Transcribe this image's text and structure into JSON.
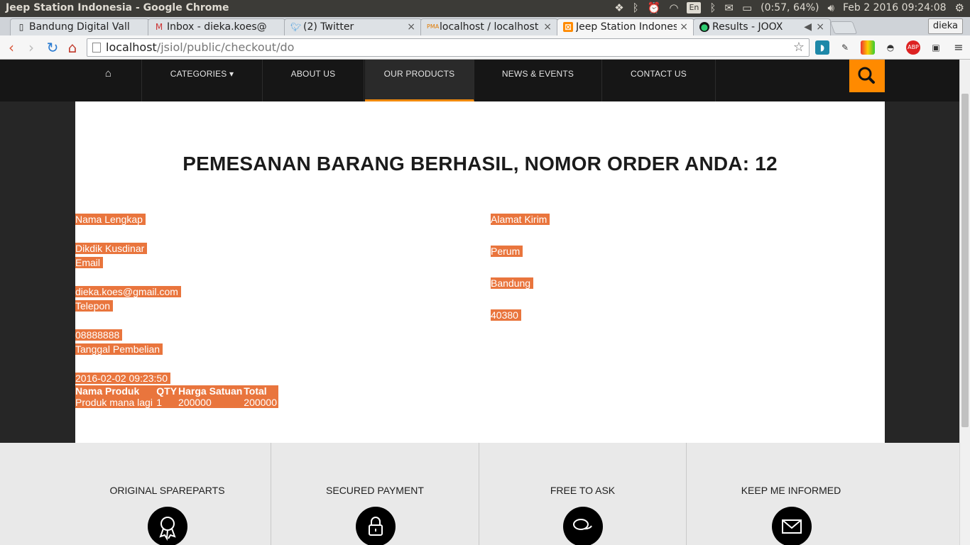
{
  "os": {
    "window_title": "Jeep Station Indonesia - Google Chrome",
    "language": "En",
    "battery": "(0:57, 64%)",
    "datetime": "Feb 2 2016 09:24:08"
  },
  "browser": {
    "tabs": [
      {
        "label": "Bandung Digital Vall",
        "icon": "page-icon"
      },
      {
        "label": "Inbox - dieka.koes@",
        "icon": "gmail-icon"
      },
      {
        "label": "(2) Twitter",
        "icon": "twitter-icon"
      },
      {
        "label": "localhost / localhost",
        "icon": "pma-icon"
      },
      {
        "label": "Jeep Station Indones",
        "icon": "site-icon"
      },
      {
        "label": "Results - JOOX",
        "icon": "joox-icon"
      }
    ],
    "profile": "dieka",
    "url_host": "localhost",
    "url_path": "/jsiol/public/checkout/do"
  },
  "site": {
    "nav": {
      "home": "⌂",
      "items": [
        "CATEGORIES ▾",
        "ABOUT US",
        "OUR PRODUCTS",
        "NEWS & EVENTS",
        "CONTACT US"
      ]
    },
    "headline": "PEMESANAN BARANG BERHASIL, NOMOR ORDER ANDA: 12",
    "customer": {
      "name_label": "Nama Lengkap",
      "name": "Dikdik Kusdinar",
      "email_label": "Email",
      "email": "dieka.koes@gmail.com",
      "phone_label": "Telepon",
      "phone": "08888888",
      "date_label": "Tanggal Pembelian",
      "date": "2016-02-02 09:23:50"
    },
    "shipping": {
      "label": "Alamat Kirim",
      "lines": [
        "Perum",
        "Bandung",
        "40380"
      ]
    },
    "order": {
      "headers": [
        "Nama Produk",
        "QTY",
        "Harga Satuan",
        "Total"
      ],
      "rows": [
        [
          "Produk mana lagi",
          "1",
          "200000",
          "200000"
        ]
      ]
    },
    "features": [
      {
        "title": "ORIGINAL SPAREPARTS",
        "icon": "award-icon"
      },
      {
        "title": "SECURED PAYMENT",
        "icon": "lock-icon"
      },
      {
        "title": "FREE TO ASK",
        "icon": "chat-icon"
      },
      {
        "title": "KEEP ME INFORMED",
        "icon": "mail-icon"
      }
    ]
  }
}
